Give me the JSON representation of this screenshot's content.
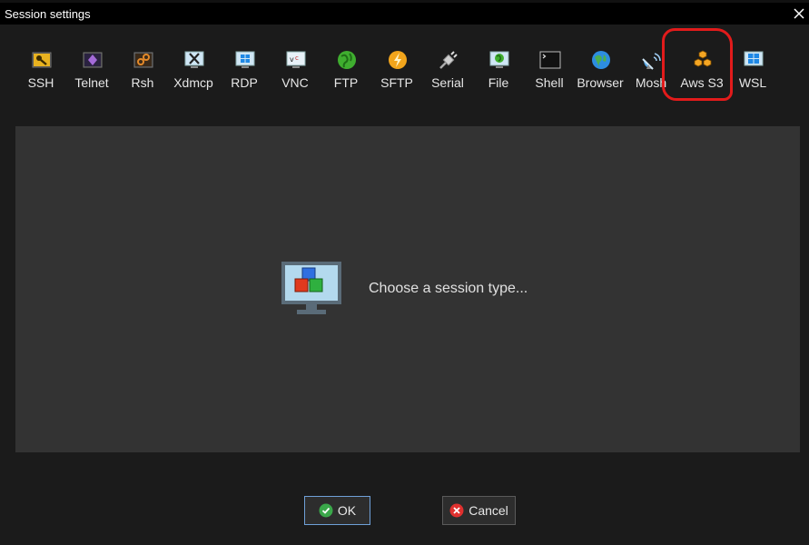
{
  "window": {
    "title": "Session settings"
  },
  "toolbar": {
    "items": [
      {
        "label": "SSH",
        "icon": "ssh-key-icon"
      },
      {
        "label": "Telnet",
        "icon": "telnet-icon"
      },
      {
        "label": "Rsh",
        "icon": "rsh-icon"
      },
      {
        "label": "Xdmcp",
        "icon": "xdmcp-icon"
      },
      {
        "label": "RDP",
        "icon": "rdp-icon"
      },
      {
        "label": "VNC",
        "icon": "vnc-icon"
      },
      {
        "label": "FTP",
        "icon": "ftp-globe-icon"
      },
      {
        "label": "SFTP",
        "icon": "sftp-icon"
      },
      {
        "label": "Serial",
        "icon": "serial-plug-icon"
      },
      {
        "label": "File",
        "icon": "file-icon"
      },
      {
        "label": "Shell",
        "icon": "shell-terminal-icon"
      },
      {
        "label": "Browser",
        "icon": "browser-globe-icon"
      },
      {
        "label": "Mosh",
        "icon": "mosh-satellite-icon"
      },
      {
        "label": "Aws S3",
        "icon": "aws-s3-cubes-icon"
      },
      {
        "label": "WSL",
        "icon": "wsl-windows-icon"
      }
    ]
  },
  "main": {
    "prompt": "Choose a session type..."
  },
  "buttons": {
    "ok": "OK",
    "cancel": "Cancel"
  },
  "colors": {
    "annotation": "#e21b1b",
    "panel": "#333333",
    "background": "#1b1b1b"
  }
}
